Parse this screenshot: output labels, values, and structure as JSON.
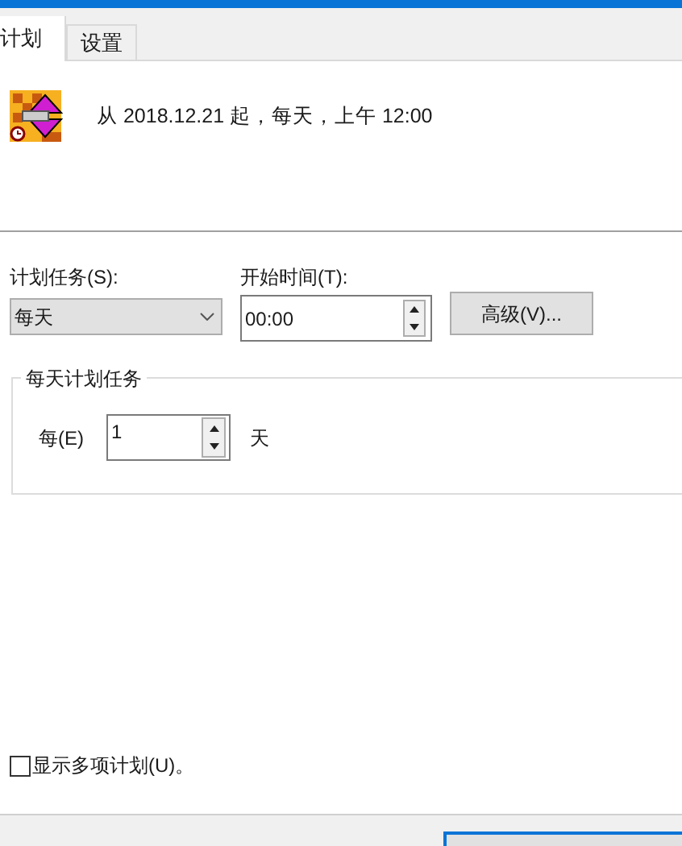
{
  "tabs": [
    {
      "label": "计划",
      "selected": true
    },
    {
      "label": "设置",
      "selected": false
    }
  ],
  "summary": "从 2018.12.21 起，每天，上午 12:00",
  "schedule_task": {
    "label": "计划任务(S):",
    "value": "每天"
  },
  "start_time": {
    "label": "开始时间(T):",
    "value": "00:00"
  },
  "advanced_button": "高级(V)...",
  "group": {
    "title": "每天计划任务",
    "every_label": "每(E)",
    "every_value": "1",
    "unit": "天"
  },
  "show_multiple": {
    "label": "显示多项计划(U)。",
    "checked": false
  }
}
